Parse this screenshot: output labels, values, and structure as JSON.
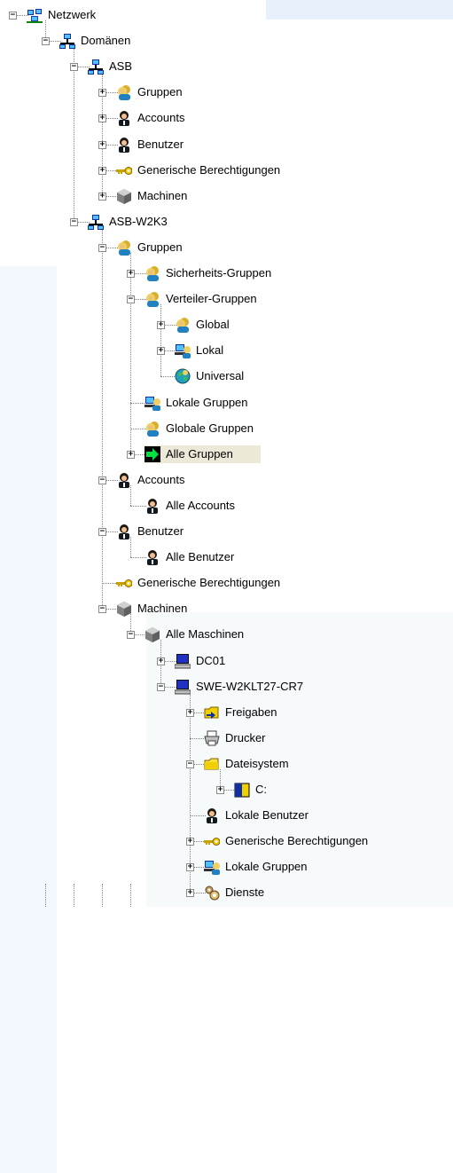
{
  "tree": {
    "nodes": [
      {
        "label": "Netzwerk",
        "icon": "network-icon",
        "state": "expanded",
        "depth": 0
      },
      {
        "label": "Domänen",
        "icon": "domain-icon",
        "state": "expanded",
        "depth": 1
      },
      {
        "label": "ASB",
        "icon": "domain-icon",
        "state": "expanded",
        "depth": 2
      },
      {
        "label": "Gruppen",
        "icon": "group-icon",
        "state": "collapsed",
        "depth": 3
      },
      {
        "label": "Accounts",
        "icon": "user-icon",
        "state": "collapsed",
        "depth": 3
      },
      {
        "label": "Benutzer",
        "icon": "user-icon",
        "state": "collapsed",
        "depth": 3
      },
      {
        "label": "Generische Berechtigungen",
        "icon": "key-icon",
        "state": "collapsed",
        "depth": 3
      },
      {
        "label": "Machinen",
        "icon": "machine-icon",
        "state": "collapsed",
        "depth": 3
      },
      {
        "label": "ASB-W2K3",
        "icon": "domain-icon",
        "state": "expanded",
        "depth": 2
      },
      {
        "label": "Gruppen",
        "icon": "group-icon",
        "state": "expanded",
        "depth": 3
      },
      {
        "label": "Sicherheits-Gruppen",
        "icon": "group-icon",
        "state": "collapsed",
        "depth": 4
      },
      {
        "label": "Verteiler-Gruppen",
        "icon": "group-icon",
        "state": "expanded",
        "depth": 4
      },
      {
        "label": "Global",
        "icon": "group-icon",
        "state": "collapsed",
        "depth": 5
      },
      {
        "label": "Lokal",
        "icon": "local-group-icon",
        "state": "collapsed",
        "depth": 5
      },
      {
        "label": "Universal",
        "icon": "globe-icon",
        "state": "leaf",
        "depth": 5
      },
      {
        "label": "Lokale Gruppen",
        "icon": "local-group-icon",
        "state": "leaf",
        "depth": 4
      },
      {
        "label": "Globale Gruppen",
        "icon": "group-icon",
        "state": "leaf",
        "depth": 4
      },
      {
        "label": "Alle Gruppen",
        "icon": "arrow-right-icon",
        "state": "collapsed",
        "depth": 4,
        "selected": true
      },
      {
        "label": "Accounts",
        "icon": "user-icon",
        "state": "expanded",
        "depth": 3
      },
      {
        "label": "Alle Accounts",
        "icon": "user-icon",
        "state": "leaf",
        "depth": 4
      },
      {
        "label": "Benutzer",
        "icon": "user-icon",
        "state": "expanded",
        "depth": 3
      },
      {
        "label": "Alle Benutzer",
        "icon": "user-icon",
        "state": "leaf",
        "depth": 4
      },
      {
        "label": "Generische Berechtigungen",
        "icon": "key-icon",
        "state": "leaf",
        "depth": 3
      },
      {
        "label": "Machinen",
        "icon": "machine-icon",
        "state": "expanded",
        "depth": 3
      },
      {
        "label": "Alle Maschinen",
        "icon": "machine-icon",
        "state": "expanded",
        "depth": 4
      },
      {
        "label": "DC01",
        "icon": "computer-icon",
        "state": "collapsed",
        "depth": 5
      },
      {
        "label": "SWE-W2KLT27-CR7",
        "icon": "computer-icon",
        "state": "expanded",
        "depth": 5
      },
      {
        "label": "Freigaben",
        "icon": "shared-folder-icon",
        "state": "collapsed",
        "depth": 6
      },
      {
        "label": "Drucker",
        "icon": "printer-icon",
        "state": "leaf",
        "depth": 6
      },
      {
        "label": "Dateisystem",
        "icon": "folder-icon",
        "state": "expanded",
        "depth": 6
      },
      {
        "label": "C:",
        "icon": "drive-icon",
        "state": "collapsed",
        "depth": 7
      },
      {
        "label": "Lokale Benutzer",
        "icon": "user-icon",
        "state": "leaf",
        "depth": 6
      },
      {
        "label": "Generische Berechtigungen",
        "icon": "key-icon",
        "state": "collapsed",
        "depth": 6
      },
      {
        "label": "Lokale Gruppen",
        "icon": "local-group-icon",
        "state": "collapsed",
        "depth": 6
      },
      {
        "label": "Dienste",
        "icon": "services-icon",
        "state": "collapsed",
        "depth": 6
      }
    ]
  }
}
